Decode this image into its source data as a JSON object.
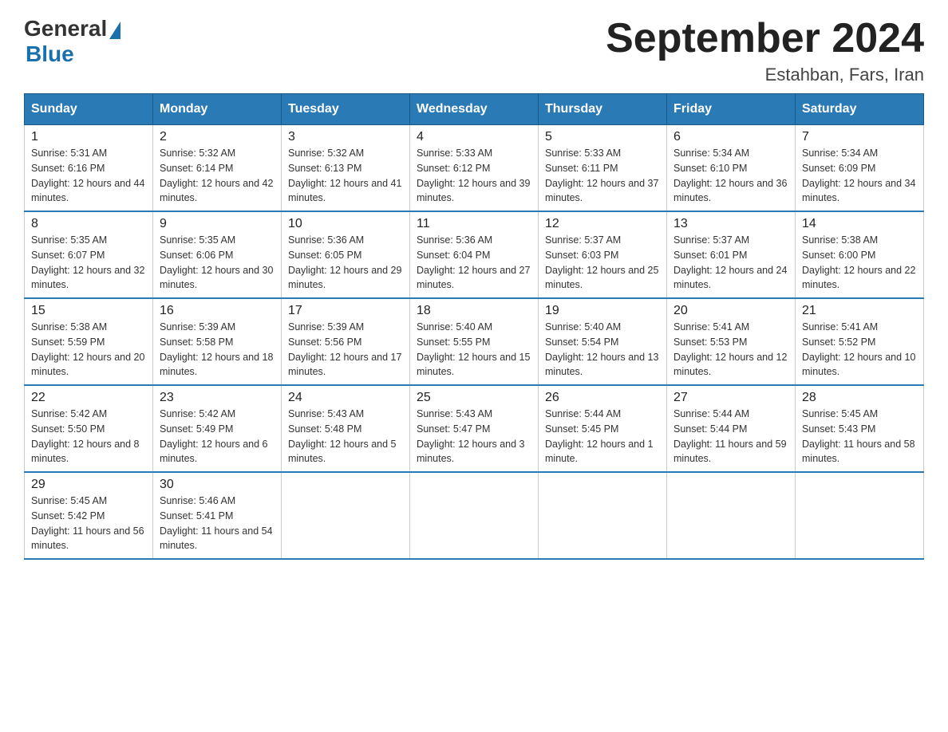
{
  "logo": {
    "general": "General",
    "blue": "Blue"
  },
  "title": "September 2024",
  "subtitle": "Estahban, Fars, Iran",
  "days_header": [
    "Sunday",
    "Monday",
    "Tuesday",
    "Wednesday",
    "Thursday",
    "Friday",
    "Saturday"
  ],
  "weeks": [
    [
      {
        "num": "1",
        "sunrise": "5:31 AM",
        "sunset": "6:16 PM",
        "daylight": "12 hours and 44 minutes."
      },
      {
        "num": "2",
        "sunrise": "5:32 AM",
        "sunset": "6:14 PM",
        "daylight": "12 hours and 42 minutes."
      },
      {
        "num": "3",
        "sunrise": "5:32 AM",
        "sunset": "6:13 PM",
        "daylight": "12 hours and 41 minutes."
      },
      {
        "num": "4",
        "sunrise": "5:33 AM",
        "sunset": "6:12 PM",
        "daylight": "12 hours and 39 minutes."
      },
      {
        "num": "5",
        "sunrise": "5:33 AM",
        "sunset": "6:11 PM",
        "daylight": "12 hours and 37 minutes."
      },
      {
        "num": "6",
        "sunrise": "5:34 AM",
        "sunset": "6:10 PM",
        "daylight": "12 hours and 36 minutes."
      },
      {
        "num": "7",
        "sunrise": "5:34 AM",
        "sunset": "6:09 PM",
        "daylight": "12 hours and 34 minutes."
      }
    ],
    [
      {
        "num": "8",
        "sunrise": "5:35 AM",
        "sunset": "6:07 PM",
        "daylight": "12 hours and 32 minutes."
      },
      {
        "num": "9",
        "sunrise": "5:35 AM",
        "sunset": "6:06 PM",
        "daylight": "12 hours and 30 minutes."
      },
      {
        "num": "10",
        "sunrise": "5:36 AM",
        "sunset": "6:05 PM",
        "daylight": "12 hours and 29 minutes."
      },
      {
        "num": "11",
        "sunrise": "5:36 AM",
        "sunset": "6:04 PM",
        "daylight": "12 hours and 27 minutes."
      },
      {
        "num": "12",
        "sunrise": "5:37 AM",
        "sunset": "6:03 PM",
        "daylight": "12 hours and 25 minutes."
      },
      {
        "num": "13",
        "sunrise": "5:37 AM",
        "sunset": "6:01 PM",
        "daylight": "12 hours and 24 minutes."
      },
      {
        "num": "14",
        "sunrise": "5:38 AM",
        "sunset": "6:00 PM",
        "daylight": "12 hours and 22 minutes."
      }
    ],
    [
      {
        "num": "15",
        "sunrise": "5:38 AM",
        "sunset": "5:59 PM",
        "daylight": "12 hours and 20 minutes."
      },
      {
        "num": "16",
        "sunrise": "5:39 AM",
        "sunset": "5:58 PM",
        "daylight": "12 hours and 18 minutes."
      },
      {
        "num": "17",
        "sunrise": "5:39 AM",
        "sunset": "5:56 PM",
        "daylight": "12 hours and 17 minutes."
      },
      {
        "num": "18",
        "sunrise": "5:40 AM",
        "sunset": "5:55 PM",
        "daylight": "12 hours and 15 minutes."
      },
      {
        "num": "19",
        "sunrise": "5:40 AM",
        "sunset": "5:54 PM",
        "daylight": "12 hours and 13 minutes."
      },
      {
        "num": "20",
        "sunrise": "5:41 AM",
        "sunset": "5:53 PM",
        "daylight": "12 hours and 12 minutes."
      },
      {
        "num": "21",
        "sunrise": "5:41 AM",
        "sunset": "5:52 PM",
        "daylight": "12 hours and 10 minutes."
      }
    ],
    [
      {
        "num": "22",
        "sunrise": "5:42 AM",
        "sunset": "5:50 PM",
        "daylight": "12 hours and 8 minutes."
      },
      {
        "num": "23",
        "sunrise": "5:42 AM",
        "sunset": "5:49 PM",
        "daylight": "12 hours and 6 minutes."
      },
      {
        "num": "24",
        "sunrise": "5:43 AM",
        "sunset": "5:48 PM",
        "daylight": "12 hours and 5 minutes."
      },
      {
        "num": "25",
        "sunrise": "5:43 AM",
        "sunset": "5:47 PM",
        "daylight": "12 hours and 3 minutes."
      },
      {
        "num": "26",
        "sunrise": "5:44 AM",
        "sunset": "5:45 PM",
        "daylight": "12 hours and 1 minute."
      },
      {
        "num": "27",
        "sunrise": "5:44 AM",
        "sunset": "5:44 PM",
        "daylight": "11 hours and 59 minutes."
      },
      {
        "num": "28",
        "sunrise": "5:45 AM",
        "sunset": "5:43 PM",
        "daylight": "11 hours and 58 minutes."
      }
    ],
    [
      {
        "num": "29",
        "sunrise": "5:45 AM",
        "sunset": "5:42 PM",
        "daylight": "11 hours and 56 minutes."
      },
      {
        "num": "30",
        "sunrise": "5:46 AM",
        "sunset": "5:41 PM",
        "daylight": "11 hours and 54 minutes."
      },
      null,
      null,
      null,
      null,
      null
    ]
  ]
}
